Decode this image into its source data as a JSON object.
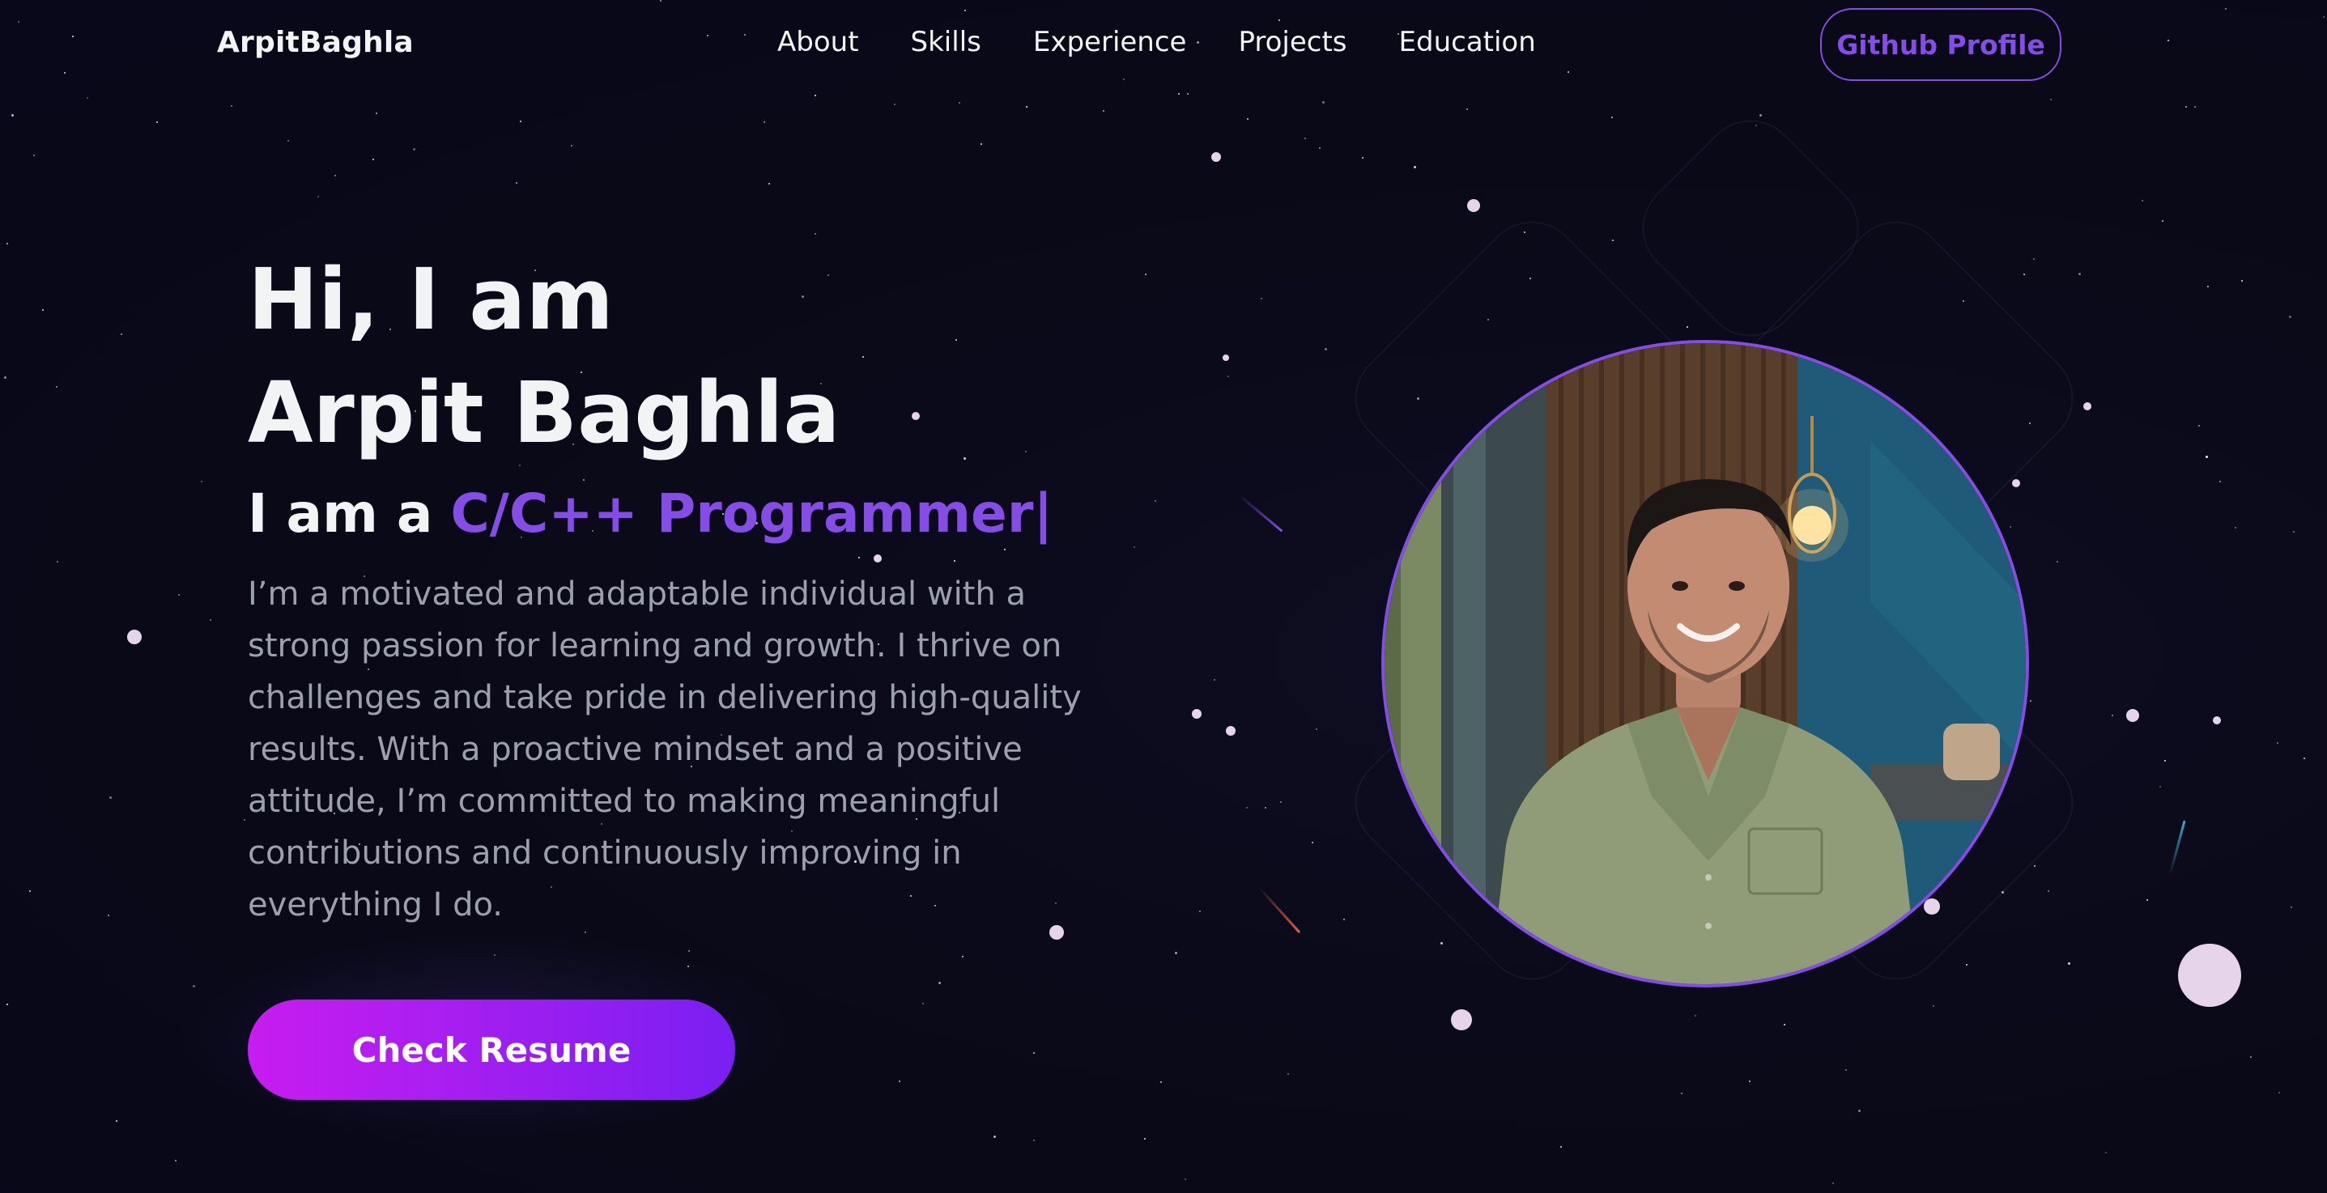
{
  "nav": {
    "logo": "ArpitBaghla",
    "links": [
      "About",
      "Skills",
      "Experience",
      "Projects",
      "Education"
    ],
    "github_label": "Github Profile"
  },
  "hero": {
    "title_line1": "Hi, I am",
    "title_line2": "Arpit Baghla",
    "subtitle_prefix": "I am a",
    "subtitle_role": "C/C++ Programmer",
    "subtitle_cursor": "|",
    "description": "I’m a motivated and adaptable individual with a strong passion for learning and growth. I thrive on challenges and take pride in delivering high-quality results. With a proactive mindset and a positive attitude, I’m committed to making meaningful contributions and continuously improving in everything I do.",
    "resume_label": "Check Resume"
  },
  "colors": {
    "background": "#090917",
    "primary": "#854ce6",
    "text_primary": "#f2f3f4",
    "text_secondary": "#9ca0ad",
    "button_gradient_start": "#c81cf0",
    "button_gradient_end": "#7a1ff2"
  }
}
